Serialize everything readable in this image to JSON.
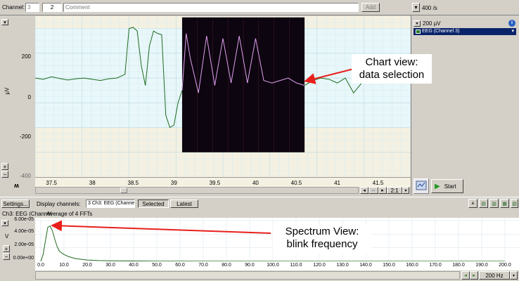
{
  "toolbar": {
    "channel_label": "Channel:",
    "channel_value": "3",
    "channel_number": "2",
    "comment_placeholder": "Comment",
    "add_label": "Add",
    "rate": "400 /s",
    "range": "200 µV",
    "channel_selector": "EEG (Channel 3)"
  },
  "chart": {
    "unit": "µV",
    "y_ticks": [
      "200",
      "0",
      "-200",
      "-400"
    ],
    "x_ticks": [
      "37.5",
      "38",
      "38.5",
      "39",
      "39.5",
      "40",
      "40.5",
      "41",
      "41.5"
    ],
    "zoom": "2:1",
    "start_label": "Start"
  },
  "chart_data": [
    {
      "type": "line",
      "ylabel": "µV",
      "xlim": [
        37.3,
        41.9
      ],
      "ylim": [
        -400,
        250
      ],
      "series": [
        {
          "x": [
            37.3,
            37.4,
            37.5,
            37.6,
            37.7,
            37.8,
            37.9,
            38.0,
            38.1,
            38.2,
            38.3,
            38.4,
            38.45,
            38.5,
            38.55,
            38.6,
            38.65,
            38.7,
            38.75,
            38.8,
            38.85,
            38.9,
            38.95,
            39.0,
            39.05,
            39.1,
            39.15,
            39.2,
            39.3,
            39.4,
            39.5,
            39.6,
            39.7,
            39.8,
            39.9,
            40.0,
            40.1,
            40.2,
            40.3,
            40.4,
            40.5,
            40.6,
            40.7,
            40.8,
            40.9,
            41.0,
            41.1,
            41.2,
            41.3,
            41.4,
            41.5,
            41.6,
            41.7,
            41.8
          ],
          "y": [
            0,
            -5,
            5,
            -2,
            -8,
            -3,
            0,
            -5,
            -10,
            -3,
            0,
            15,
            200,
            205,
            190,
            50,
            -30,
            130,
            190,
            180,
            175,
            -150,
            -200,
            -190,
            -100,
            -50,
            180,
            80,
            -60,
            170,
            -30,
            160,
            -20,
            170,
            -20,
            160,
            -10,
            -20,
            -10,
            0,
            -20,
            -30,
            -10,
            0,
            -5,
            -20,
            0,
            -60,
            -20,
            -5,
            10,
            20,
            25,
            10
          ]
        }
      ]
    },
    {
      "type": "line",
      "ylabel": "V",
      "xlim": [
        0,
        200
      ],
      "ylim": [
        0,
        6e-05
      ],
      "series": [
        {
          "x": [
            0,
            1,
            2,
            3,
            4,
            5,
            6,
            7,
            8,
            10,
            12,
            15,
            20,
            25,
            30,
            40,
            50,
            60,
            80,
            100,
            120,
            150,
            180,
            200
          ],
          "y": [
            0,
            1e-05,
            3e-05,
            5e-05,
            5.2e-05,
            4.5e-05,
            3.3e-05,
            2.2e-05,
            1.5e-05,
            1e-05,
            7e-06,
            4e-06,
            2e-06,
            1.2e-06,
            8e-07,
            5e-07,
            3e-07,
            2e-07,
            1e-07,
            1e-07,
            1e-07,
            1e-07,
            1e-07,
            1e-07
          ]
        }
      ]
    }
  ],
  "lower_toolbar": {
    "settings_label": "Settings...",
    "display_channels_label": "Display channels:",
    "display_channels_value": "3 Ch3: EEG (Channe",
    "selected_label": "Selected",
    "latest_label": "Latest"
  },
  "spectrum": {
    "info_channel": "Ch3: EEG (Channel",
    "info_average": "Average of 4 FFTs",
    "unit": "V",
    "y_ticks": [
      "6.00e-05",
      "4.00e-05",
      "2.00e-05",
      "0.00e+00"
    ],
    "x_ticks": [
      "0.0",
      "10.0",
      "20.0",
      "30.0",
      "40.0",
      "50.0",
      "60.0",
      "70.0",
      "80.0",
      "90.0",
      "100.0",
      "110.0",
      "120.0",
      "130.0",
      "140.0",
      "150.0",
      "160.0",
      "170.0",
      "180.0",
      "190.0",
      "200.0"
    ],
    "freq_readout": "200 Hz"
  },
  "callouts": {
    "chart_view": [
      "Chart view:",
      "data selection"
    ],
    "spectrum_view": [
      "Spectrum View:",
      "blink frequency"
    ]
  },
  "colors": {
    "trace": "#1f6b1f",
    "selection_bg": "#0d0510",
    "selection_trace": "#e0a0f0",
    "arrow": "#e8201c",
    "band": "#f4f1e2",
    "grid_center": "#e8f7fa"
  }
}
